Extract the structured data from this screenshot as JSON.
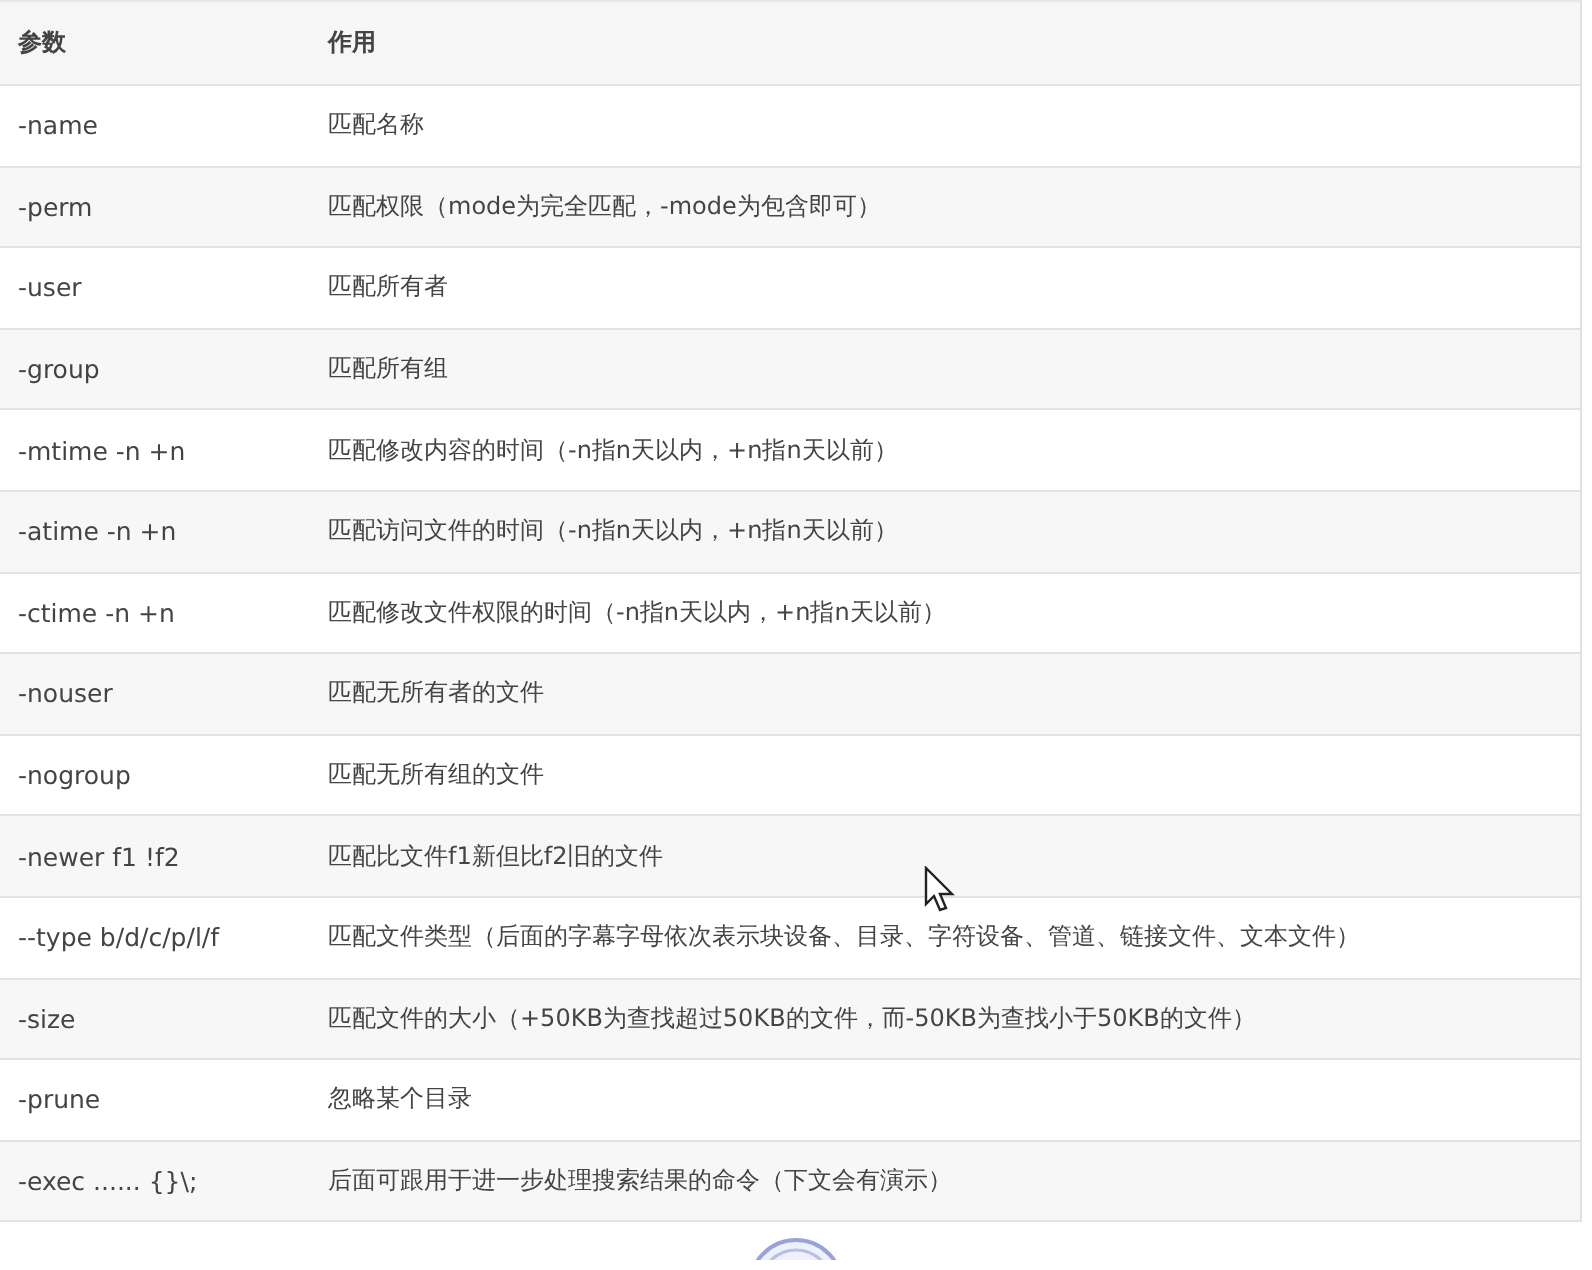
{
  "table": {
    "columns": [
      "参数",
      "作用"
    ],
    "rows": [
      [
        "-name",
        "匹配名称"
      ],
      [
        "-perm",
        "匹配权限（mode为完全匹配，-mode为包含即可）"
      ],
      [
        "-user",
        "匹配所有者"
      ],
      [
        "-group",
        "匹配所有组"
      ],
      [
        "-mtime -n +n",
        "匹配修改内容的时间（-n指n天以内，+n指n天以前）"
      ],
      [
        "-atime -n +n",
        "匹配访问文件的时间（-n指n天以内，+n指n天以前）"
      ],
      [
        "-ctime -n +n",
        "匹配修改文件权限的时间（-n指n天以内，+n指n天以前）"
      ],
      [
        "-nouser",
        "匹配无所有者的文件"
      ],
      [
        "-nogroup",
        "匹配无所有组的文件"
      ],
      [
        "-newer f1 !f2",
        "匹配比文件f1新但比f2旧的文件"
      ],
      [
        "--type b/d/c/p/l/f",
        "匹配文件类型（后面的字幕字母依次表示块设备、目录、字符设备、管道、链接文件、文本文件）"
      ],
      [
        "-size",
        "匹配文件的大小（+50KB为查找超过50KB的文件，而-50KB为查找小于50KB的文件）"
      ],
      [
        "-prune",
        "忽略某个目录"
      ],
      [
        "-exec ...... {}\\;",
        "后面可跟用于进一步处理搜索结果的命令（下文会有演示）"
      ]
    ]
  }
}
